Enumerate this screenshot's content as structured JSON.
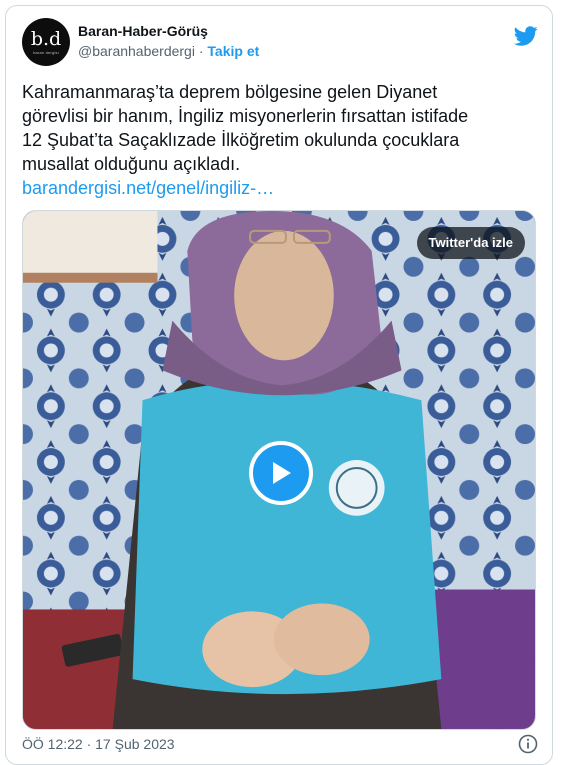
{
  "account": {
    "avatar_mono": "b.d",
    "avatar_sub": "baran dergisi",
    "name": "Baran-Haber-Görüş",
    "handle": "@baranhaberdergi",
    "separator": "·",
    "follow_label": "Takip et"
  },
  "tweet": {
    "lines": [
      "Kahramanmaraş’ta deprem bölgesine gelen Diyanet",
      "görevlisi bir hanım, İngiliz misyonerlerin fırsattan istifade",
      "12 Şubat’ta Saçaklızade İlköğretim okulunda çocuklara",
      "musallat olduğunu açıkladı."
    ],
    "link": "barandergisi.net/genel/ingiliz-…"
  },
  "media": {
    "watch_label": "Twitter'da izle",
    "play_icon": "play-icon"
  },
  "footer": {
    "timestamp": "ÖÖ 12:22 · 17 Şub 2023"
  },
  "colors": {
    "accent": "#1d9bf0",
    "text": "#0f1419",
    "muted": "#536471",
    "border": "#cfd9de",
    "vest": "#3fb6d6"
  }
}
